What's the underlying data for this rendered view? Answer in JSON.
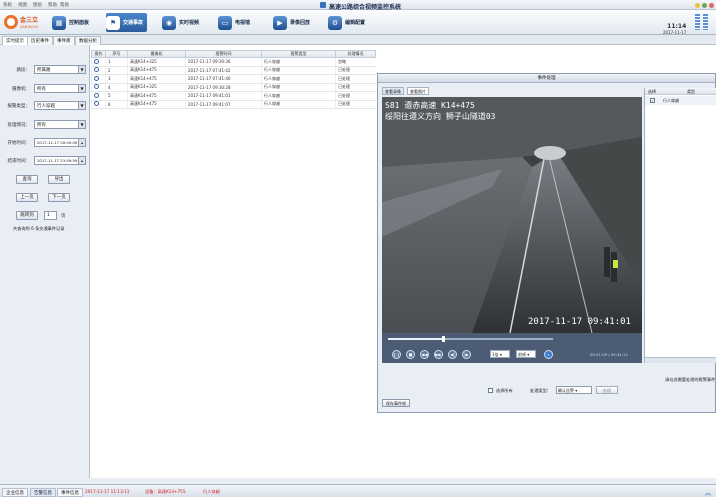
{
  "menu": {
    "items": [
      "系统",
      "视图",
      "图层",
      "帮助",
      "帮助"
    ]
  },
  "app_title": "高速公路综合视频监控系统",
  "logo": {
    "brand": "金三立",
    "sub": "SANTACHI"
  },
  "nav": [
    {
      "label": "控制面板",
      "icon": "dashboard-icon"
    },
    {
      "label": "交通事故",
      "icon": "accident-icon"
    },
    {
      "label": "实时视频",
      "icon": "camera-icon"
    },
    {
      "label": "电视墙",
      "icon": "tv-wall-icon"
    },
    {
      "label": "录像回放",
      "icon": "playback-icon"
    },
    {
      "label": "编辑配置",
      "icon": "config-icon"
    }
  ],
  "clock": {
    "time": "11:14",
    "date": "2017-11-17"
  },
  "tabs": [
    "实时提示",
    "历史事件",
    "事件库",
    "数据分析"
  ],
  "filter": {
    "road_label": "路段：",
    "road_value": "所属路",
    "camera_label": "摄像机：",
    "camera_value": "所有",
    "alarm_type_label": "报警类型：",
    "alarm_type_value": "行人穿越",
    "handle_label": "处理情况：",
    "handle_value": "所有",
    "start_label": "开始时间：",
    "start_value": "2017-11-17 00:00:00",
    "end_label": "结束时间：",
    "end_value": "2017-11-17 23:59:59",
    "query_btn": "查询",
    "export_btn": "导出",
    "prev_btn": "上一页",
    "next_btn": "下一页",
    "jump_btn": "跳转到",
    "page_input": "1",
    "page_unit": "页",
    "summary": "共查询到 6 条交通事件记录"
  },
  "grid": {
    "headers": [
      "操作",
      "序号",
      "摄像机",
      "报警时间",
      "报警类型",
      "处理情况"
    ],
    "rows": [
      [
        "",
        "1",
        "高速K14+325",
        "2017-11-17 09:30:36",
        "行人穿越",
        "忽略"
      ],
      [
        "",
        "2",
        "高速K14+475",
        "2017-11-17 07:41:42",
        "行人穿越",
        "已处理"
      ],
      [
        "",
        "3",
        "高速K14+475",
        "2017-11-17 07:41:46",
        "行人穿越",
        "已处理"
      ],
      [
        "",
        "4",
        "高速K14+325",
        "2017-11-17 09:30:28",
        "行人穿越",
        "已处理"
      ],
      [
        "",
        "5",
        "高速K14+475",
        "2017-11-17 09:41:01",
        "行人穿越",
        "已处理"
      ],
      [
        "",
        "6",
        "高速K14+475",
        "2017-11-17 09:41:07",
        "行人穿越",
        "已处理"
      ]
    ]
  },
  "popup": {
    "title": "事件处理",
    "tabs": [
      "查看录像",
      "查看图片"
    ],
    "overlay_line1": "S81 遵赤高速 K14+475",
    "overlay_line2": "绥阳往遵义方向 狮子山隧道03",
    "overlay_time": "2017-11-17 09:41:01",
    "playback_time": "09:41:09 / 09:41:12",
    "speed_value": "1倍",
    "frame_value": "前帧",
    "list_headers": [
      "选择",
      "类型"
    ],
    "list_rows": [
      {
        "checked": true,
        "type": "行人穿越"
      }
    ],
    "hint": "请勾选需要处理的报警事件",
    "select_all": "选择所有",
    "handle_type_label": "处理类型：",
    "handle_type_value": "确认告警",
    "handle_btn": "处理",
    "save_btn": "保存事件帧"
  },
  "statusbar": {
    "tabs": [
      "企业信息",
      "告警信息",
      "事件信息"
    ],
    "msg_time": "2017-11-17 11:13:11",
    "msg_device": "设备：高速K14+755",
    "msg_type": "行人穿越"
  }
}
